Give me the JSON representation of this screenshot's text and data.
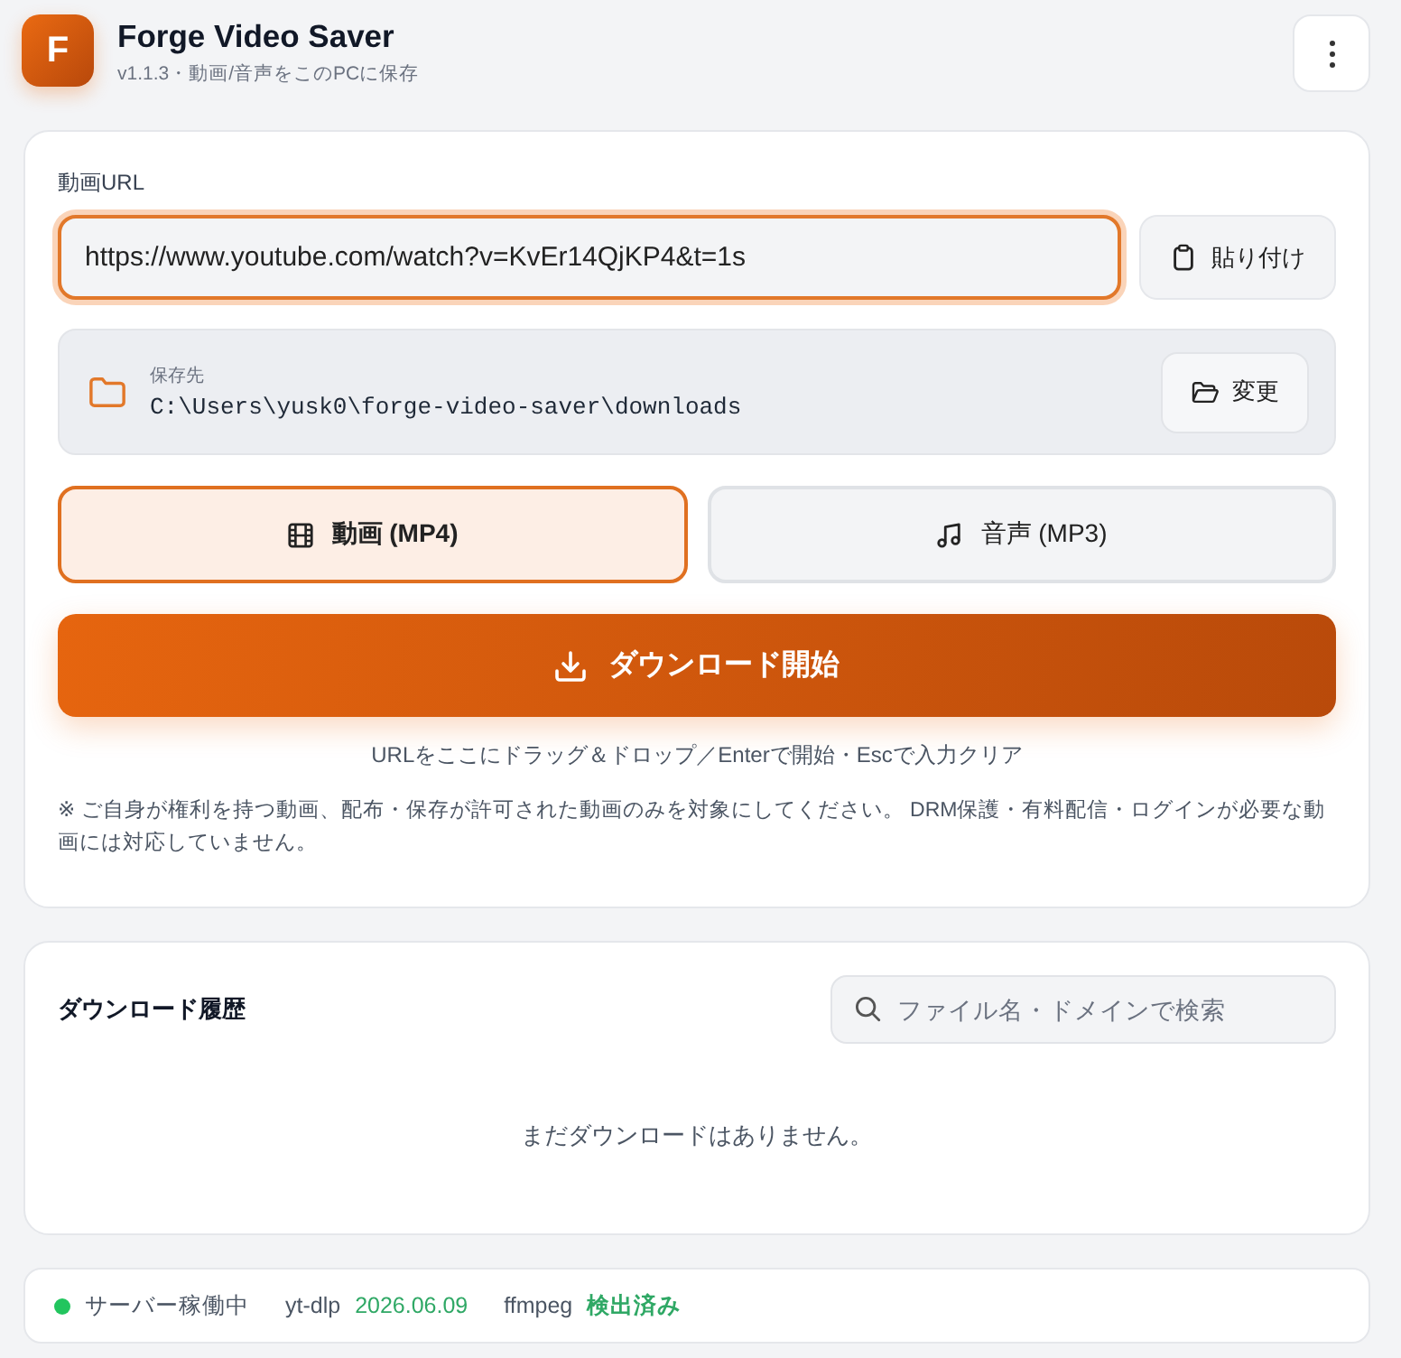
{
  "app": {
    "logo_letter": "F",
    "title": "Forge Video Saver",
    "subtitle": "v1.1.3・動画/音声をこのPCに保存"
  },
  "url_field": {
    "label": "動画URL",
    "value": "https://www.youtube.com/watch?v=KvEr14QjKP4&t=1s",
    "focused": true
  },
  "paste_button": {
    "label": "貼り付け"
  },
  "save_location": {
    "label": "保存先",
    "path": "C:\\Users\\yusk0\\forge-video-saver\\downloads",
    "change_button": "変更"
  },
  "formats": [
    {
      "kind": "video",
      "label": "動画 (MP4)",
      "selected": true
    },
    {
      "kind": "audio",
      "label": "音声 (MP3)",
      "selected": false
    }
  ],
  "download_button": {
    "label": "ダウンロード開始"
  },
  "hint": "URLをここにドラッグ＆ドロップ／Enterで開始・Escで入力クリア",
  "notice": "※ ご自身が権利を持つ動画、配布・保存が許可された動画のみを対象にしてください。 DRM保護・有料配信・ログインが必要な動画には対応していません。",
  "history": {
    "title": "ダウンロード履歴",
    "search": {
      "placeholder": "ファイル名・ドメインで検索"
    },
    "empty_message": "まだダウンロードはありません。"
  },
  "status_bar": {
    "server": {
      "label": "サーバー稼働中",
      "running": true
    },
    "tools": [
      {
        "name": "yt-dlp",
        "value": "2026.06.09",
        "kind": "version"
      },
      {
        "name": "ffmpeg",
        "value": "検出済み",
        "kind": "status"
      }
    ]
  }
}
